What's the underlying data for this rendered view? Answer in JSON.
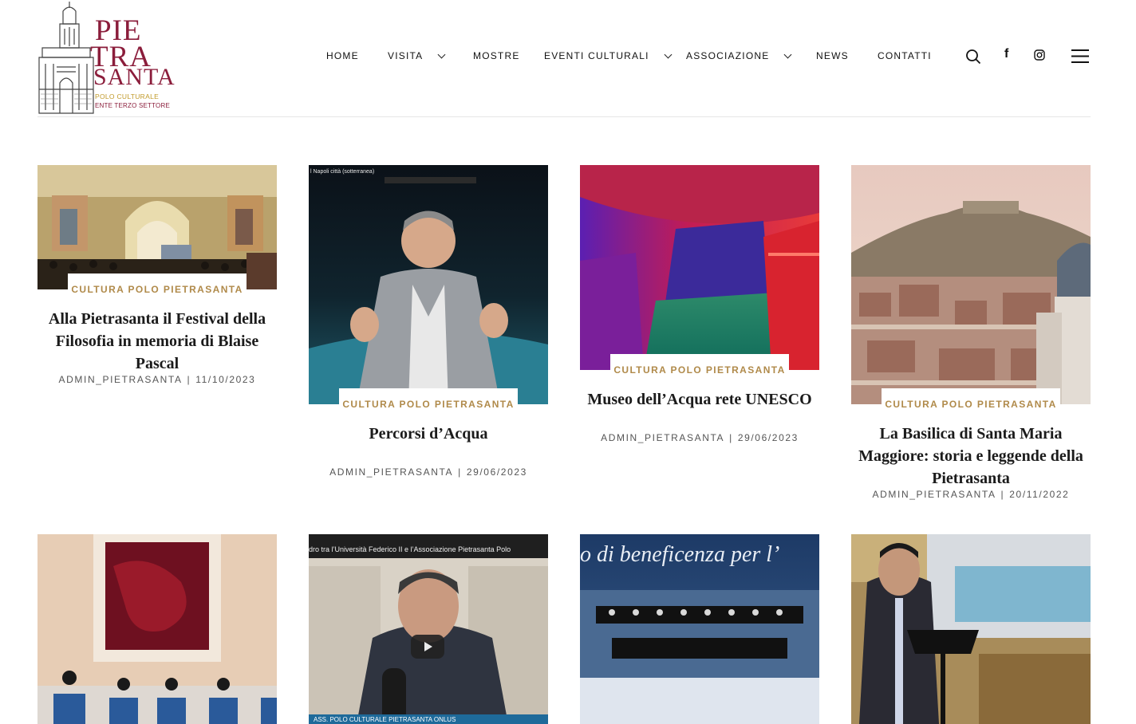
{
  "logo": {
    "line1": "PIE",
    "line2": "TRA",
    "line3": "SANTA",
    "subtitle1": "POLO CULTURALE",
    "subtitle2": "ENTE TERZO SETTORE"
  },
  "nav": {
    "items": [
      {
        "label": "HOME",
        "has_dropdown": false
      },
      {
        "label": "VISITA",
        "has_dropdown": true
      },
      {
        "label": "MOSTRE",
        "has_dropdown": false
      },
      {
        "label": "EVENTI CULTURALI",
        "has_dropdown": true
      },
      {
        "label": "ASSOCIAZIONE",
        "has_dropdown": true
      },
      {
        "label": "NEWS",
        "has_dropdown": false
      },
      {
        "label": "CONTATTI",
        "has_dropdown": false
      }
    ],
    "icons": [
      "search-icon",
      "facebook-icon",
      "instagram-icon",
      "hamburger-menu-icon"
    ]
  },
  "posts": [
    {
      "category": "CULTURA POLO PIETRASANTA",
      "title": "Alla Pietrasanta il Festival della Filosofia in memoria di Blaise Pascal",
      "author": "ADMIN_PIETRASANTA",
      "date": "11/10/2023"
    },
    {
      "category": "CULTURA POLO PIETRASANTA",
      "title": "Percorsi d’Acqua",
      "author": "ADMIN_PIETRASANTA",
      "date": "29/06/2023",
      "video_caption": "l Napoli città (sotterranea)"
    },
    {
      "category": "CULTURA POLO PIETRASANTA",
      "title": "Museo dell’Acqua rete UNESCO",
      "author": "ADMIN_PIETRASANTA",
      "date": "29/06/2023"
    },
    {
      "category": "CULTURA POLO PIETRASANTA",
      "title": "La Basilica di Santa Maria Maggiore: storia e leggende della Pietrasanta",
      "author": "ADMIN_PIETRASANTA",
      "date": "20/11/2022"
    },
    {
      "thumbnail": "painting-and-panel"
    },
    {
      "thumbnail": "video",
      "video_caption": "dro tra l’Università Federico II e l’Associazione Pietrasanta Polo",
      "video_footer": "ASS. POLO CULTURALE PIETRASANTA ONLUS"
    },
    {
      "thumbnail": "concert",
      "overlay_text": "o di beneficenza per l’"
    },
    {
      "thumbnail": "speaker-at-lectern"
    }
  ]
}
